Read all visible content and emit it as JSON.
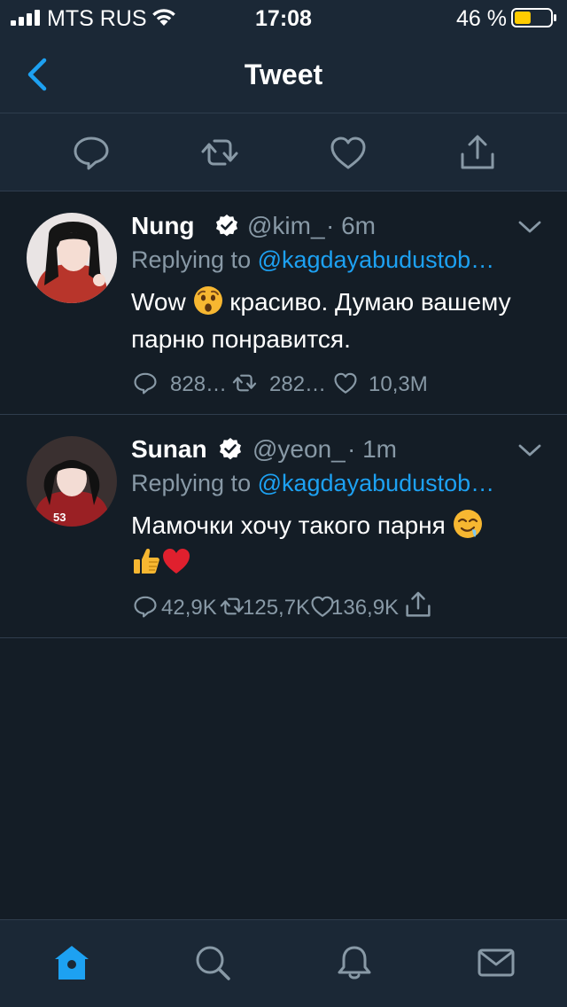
{
  "status_bar": {
    "carrier": "MTS RUS",
    "time": "17:08",
    "battery_percent": "46 %",
    "battery_level": 0.46
  },
  "nav": {
    "title": "Tweet"
  },
  "tweets": [
    {
      "name": "Nung",
      "handle": "@kim_",
      "time": "· 6m",
      "replying_prefix": "Replying to ",
      "replying_to": "@kagdayabudustob…",
      "text_before_emoji": "Wow ",
      "text_after_emoji": " красиво. Думаю вашему парню понравится.",
      "emoji": "hushed-face",
      "replies": "828…",
      "retweets": "282…",
      "likes": "10,3M"
    },
    {
      "name": "Sunan",
      "handle": "@yeon_",
      "time": "· 1m",
      "replying_prefix": "Replying to ",
      "replying_to": "@kagdayabudustob…",
      "text": "Мамочки хочу такого парня",
      "emoji": [
        "drooling-face",
        "thumbs-up",
        "red-heart"
      ],
      "replies": "42,9K",
      "retweets": "125,7K",
      "likes": "136,9K"
    }
  ],
  "colors": {
    "background": "#141d26",
    "bar": "#1b2836",
    "accent": "#1da1f2",
    "muted": "#8899a6",
    "divider": "#2f3d4d",
    "battery": "#ffcc00"
  },
  "icons": {
    "back": "chevron-left-icon",
    "reply": "reply-icon",
    "retweet": "retweet-icon",
    "like": "heart-icon",
    "share": "share-icon",
    "verified": "verified-badge-icon",
    "more": "chevron-down-icon",
    "tab_home": "home-icon",
    "tab_search": "search-icon",
    "tab_notifications": "bell-icon",
    "tab_messages": "mail-icon"
  }
}
